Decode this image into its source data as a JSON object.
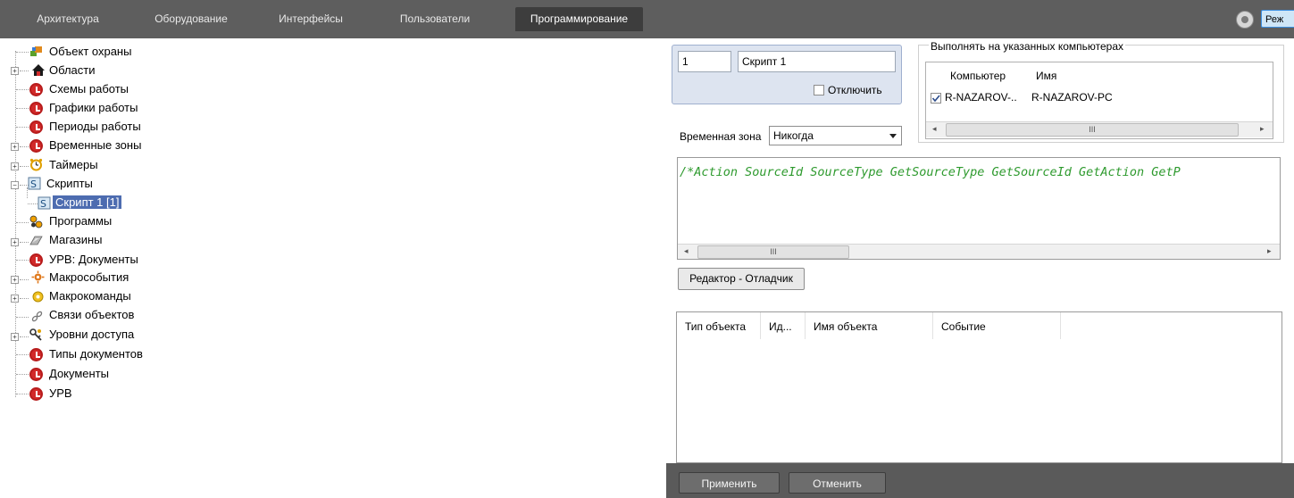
{
  "menu": {
    "tabs": [
      {
        "label": "Архитектура"
      },
      {
        "label": "Оборудование"
      },
      {
        "label": "Интерфейсы"
      },
      {
        "label": "Пользователи"
      },
      {
        "label": "Программирование"
      }
    ],
    "active_tab": "Программирование",
    "mode_label": "Реж"
  },
  "tree": {
    "items": [
      {
        "label": "Объект охраны",
        "icon": "security-object-icon"
      },
      {
        "label": "Области",
        "icon": "house-icon"
      },
      {
        "label": "Схемы работы",
        "icon": "clock-icon"
      },
      {
        "label": "Графики работы",
        "icon": "clock-icon"
      },
      {
        "label": "Периоды работы",
        "icon": "clock-icon"
      },
      {
        "label": "Временные зоны",
        "icon": "clock-icon"
      },
      {
        "label": "Таймеры",
        "icon": "timer-icon"
      },
      {
        "label": "Скрипты",
        "icon": "script-icon"
      },
      {
        "label": "Скрипт 1 [1]",
        "icon": "script-icon"
      },
      {
        "label": "Программы",
        "icon": "programs-icon"
      },
      {
        "label": "Магазины",
        "icon": "shop-icon"
      },
      {
        "label": "УРВ: Документы",
        "icon": "clock-icon"
      },
      {
        "label": "Макрособытия",
        "icon": "macro-event-icon"
      },
      {
        "label": "Макрокоманды",
        "icon": "macro-command-icon"
      },
      {
        "label": "Связи объектов",
        "icon": "link-icon"
      },
      {
        "label": "Уровни доступа",
        "icon": "keys-icon"
      },
      {
        "label": "Типы документов",
        "icon": "clock-icon"
      },
      {
        "label": "Документы",
        "icon": "clock-icon"
      },
      {
        "label": "УРВ",
        "icon": "clock-icon"
      }
    ]
  },
  "script": {
    "id": "1",
    "name": "Скрипт 1",
    "disable_label": "Отключить",
    "disabled": false,
    "timezone_label": "Временная зона",
    "timezone_value": "Никогда",
    "code": "/*Action SourceId SourceType GetSourceType GetSourceId GetAction GetP",
    "editor_button": "Редактор - Отладчик"
  },
  "computers": {
    "group_title": "Выполнять на указанных компьютерах",
    "columns": [
      "Компьютер",
      "Имя"
    ],
    "rows": [
      {
        "computer": "R-NAZAROV-..",
        "name": "R-NAZAROV-PC",
        "checked": true
      }
    ],
    "scroll_thumb": "III"
  },
  "events_table": {
    "columns": [
      "Тип объекта",
      "Ид...",
      "Имя объекта",
      "Событие"
    ]
  },
  "footer": {
    "apply_label": "Применить",
    "cancel_label": "Отменить"
  },
  "colors": {
    "topbar": "#5e5e5e",
    "panel": "#5a5a5a",
    "selection": "#4d6cb0",
    "code_text": "#2e9a2e",
    "clock_icon": "#d22a2a"
  }
}
